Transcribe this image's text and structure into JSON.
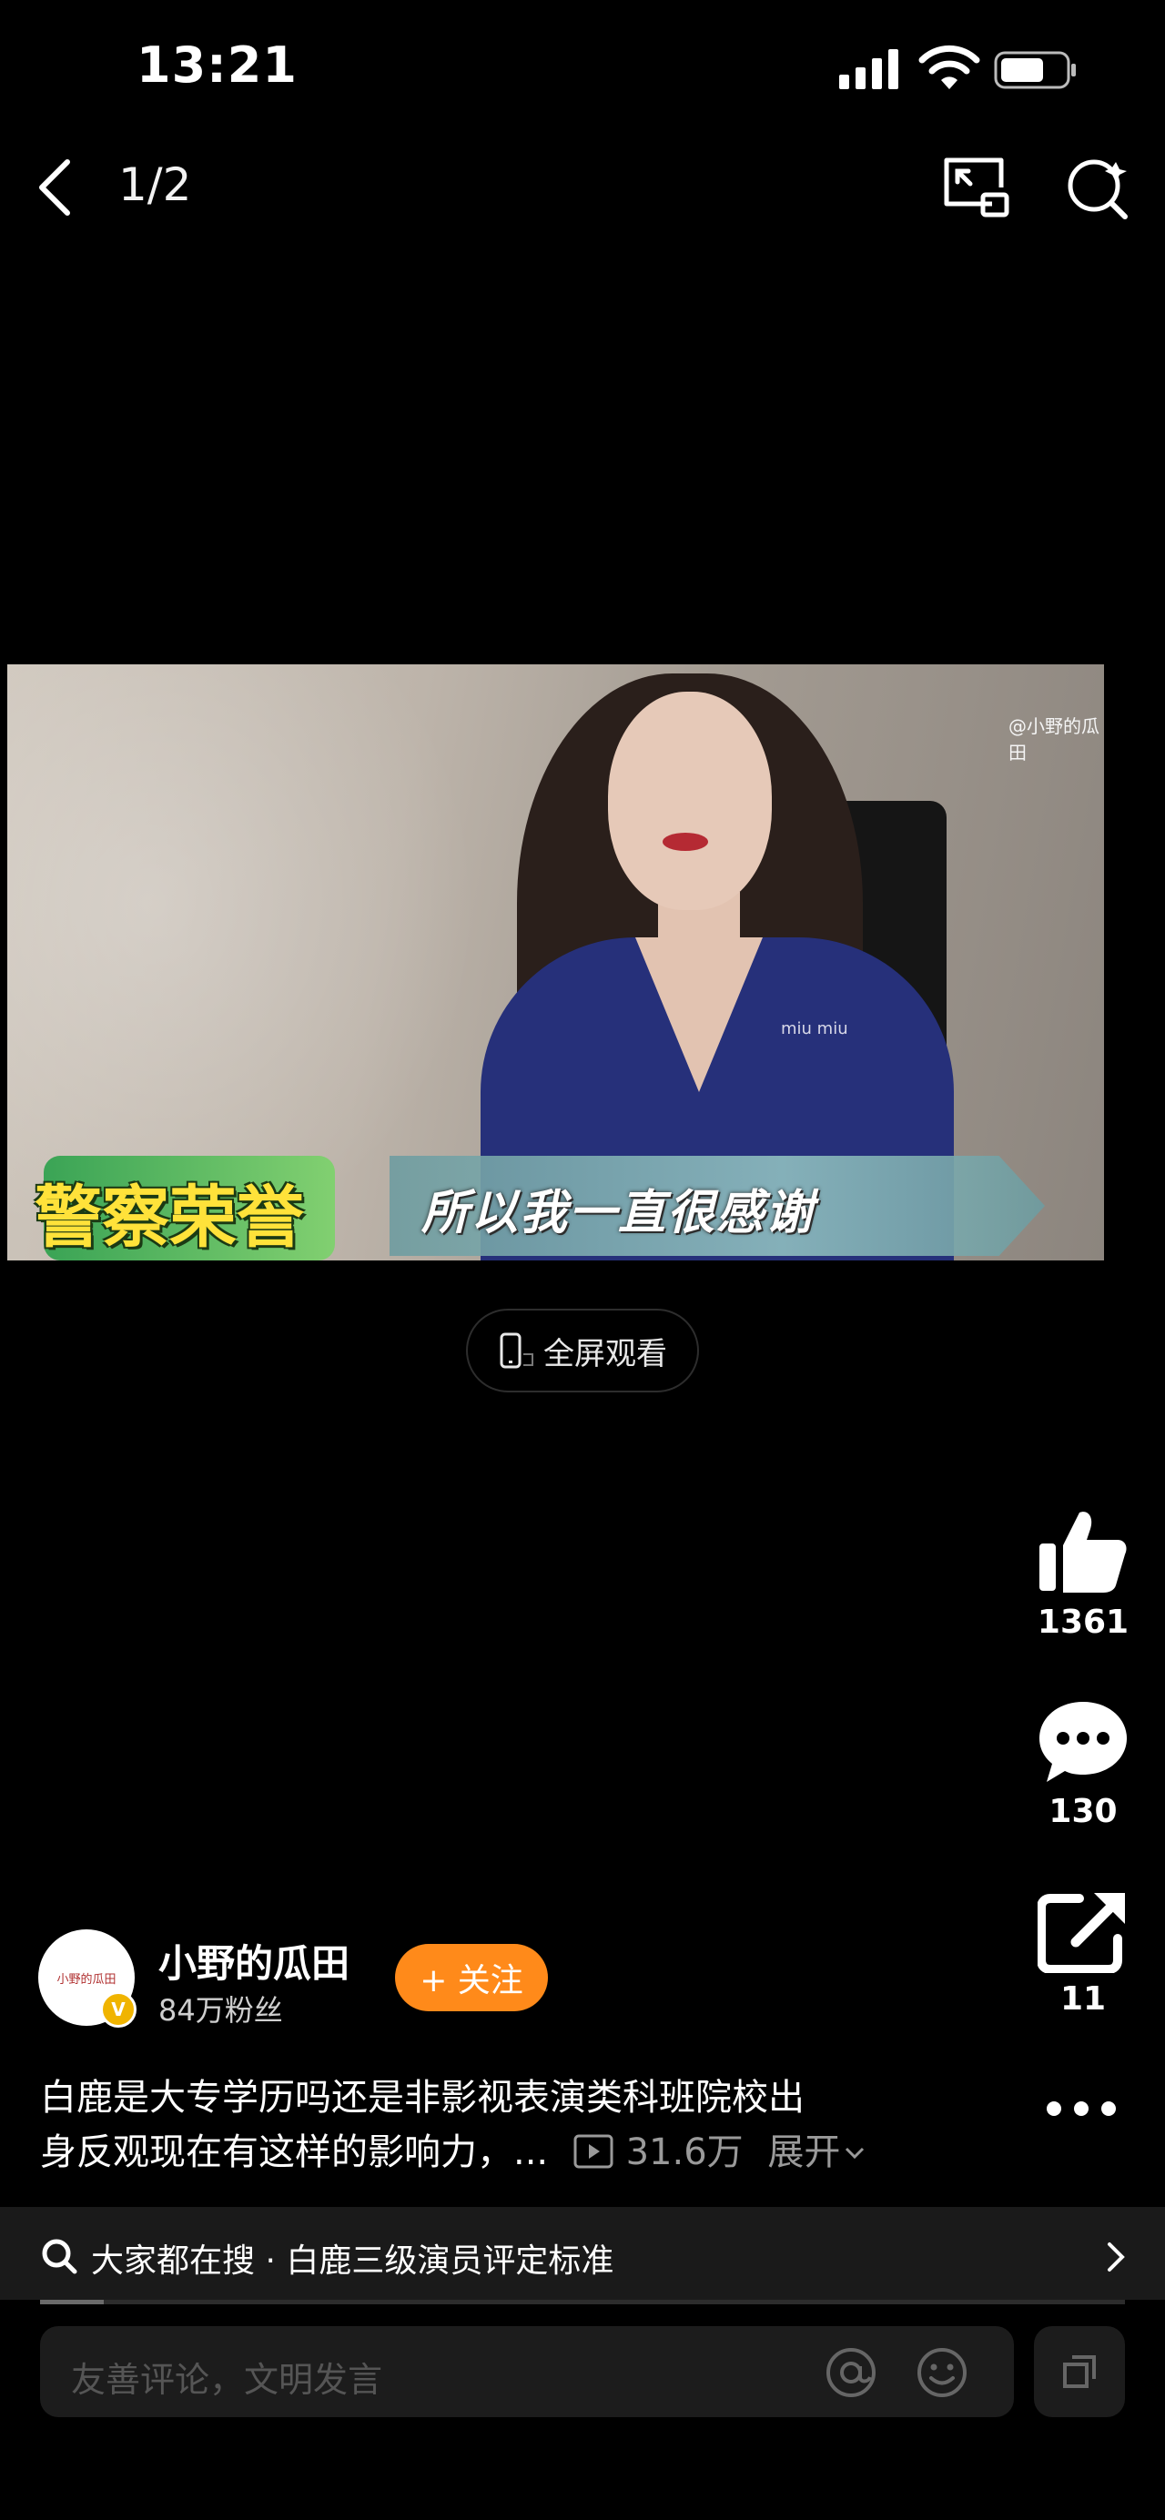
{
  "status_bar": {
    "time": "13:21"
  },
  "nav": {
    "page_indicator": "1/2"
  },
  "video": {
    "watermark": "@小野的瓜田",
    "brand_text": "miu miu",
    "show_logo": "警察荣誉",
    "subtitle": "所以我一直很感谢"
  },
  "fullscreen": {
    "label": "全屏观看"
  },
  "actions": {
    "likes": "1361",
    "comments": "130",
    "shares": "11"
  },
  "author": {
    "avatar_text": "小野的瓜田",
    "name": "小野的瓜田",
    "fans": "84万粉丝",
    "follow_label": "+ 关注"
  },
  "description": {
    "line1": "白鹿是大专学历吗还是非影视表演类科班院校出",
    "line2": "身反观现在有这样的影响力，...",
    "views": "31.6万",
    "expand": "展开"
  },
  "search_strip": {
    "text": "大家都在搜 · 白鹿三级演员评定标准"
  },
  "comment_bar": {
    "placeholder": "友善评论，文明发言"
  },
  "colors": {
    "follow": "#ff8a1a",
    "badge": "#f0b400",
    "background": "#000000"
  },
  "icons": [
    "back-icon",
    "pip-icon",
    "image-search-icon",
    "thumbs-up-icon",
    "comment-icon",
    "share-icon",
    "more-icon",
    "search-icon",
    "chevron-right-icon",
    "at-icon",
    "emoji-icon",
    "expand-icon",
    "phone-icon",
    "play-icon",
    "chevron-down-icon"
  ]
}
